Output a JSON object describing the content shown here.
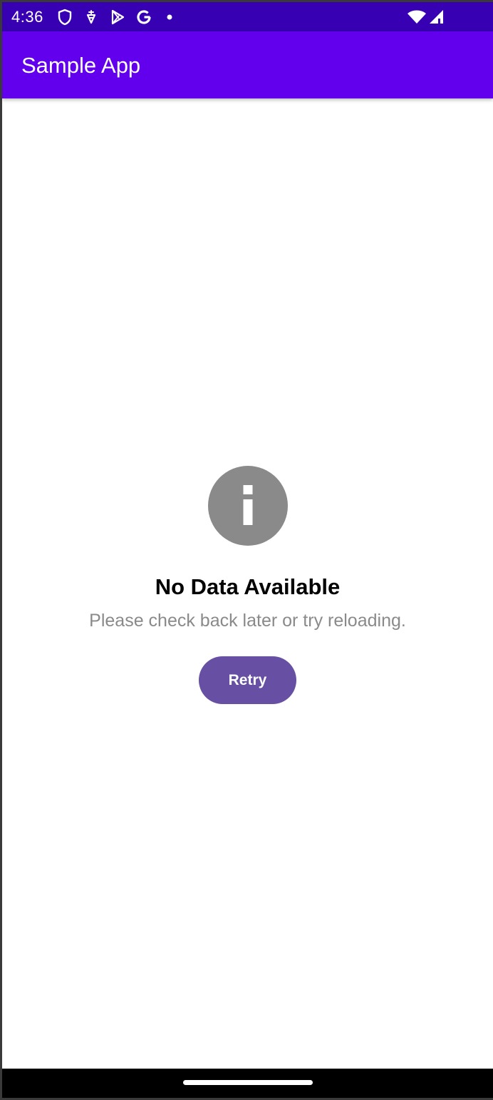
{
  "status_bar": {
    "time": "4:36",
    "left_icons": [
      "shield-icon",
      "usb-debug-icon",
      "play-store-icon",
      "google-icon",
      "notification-dot-icon"
    ],
    "right_icons": [
      "wifi-icon",
      "cell-signal-icon"
    ]
  },
  "app_bar": {
    "title": "Sample App",
    "color": "#6200EE"
  },
  "empty_state": {
    "icon": "info-icon",
    "title": "No Data Available",
    "message": "Please check back later or try reloading.",
    "retry_label": "Retry",
    "button_color": "#6750A4",
    "icon_color": "#8a8a8a"
  },
  "colors": {
    "status_bar": "#3700B3",
    "nav_bar": "#000000"
  }
}
